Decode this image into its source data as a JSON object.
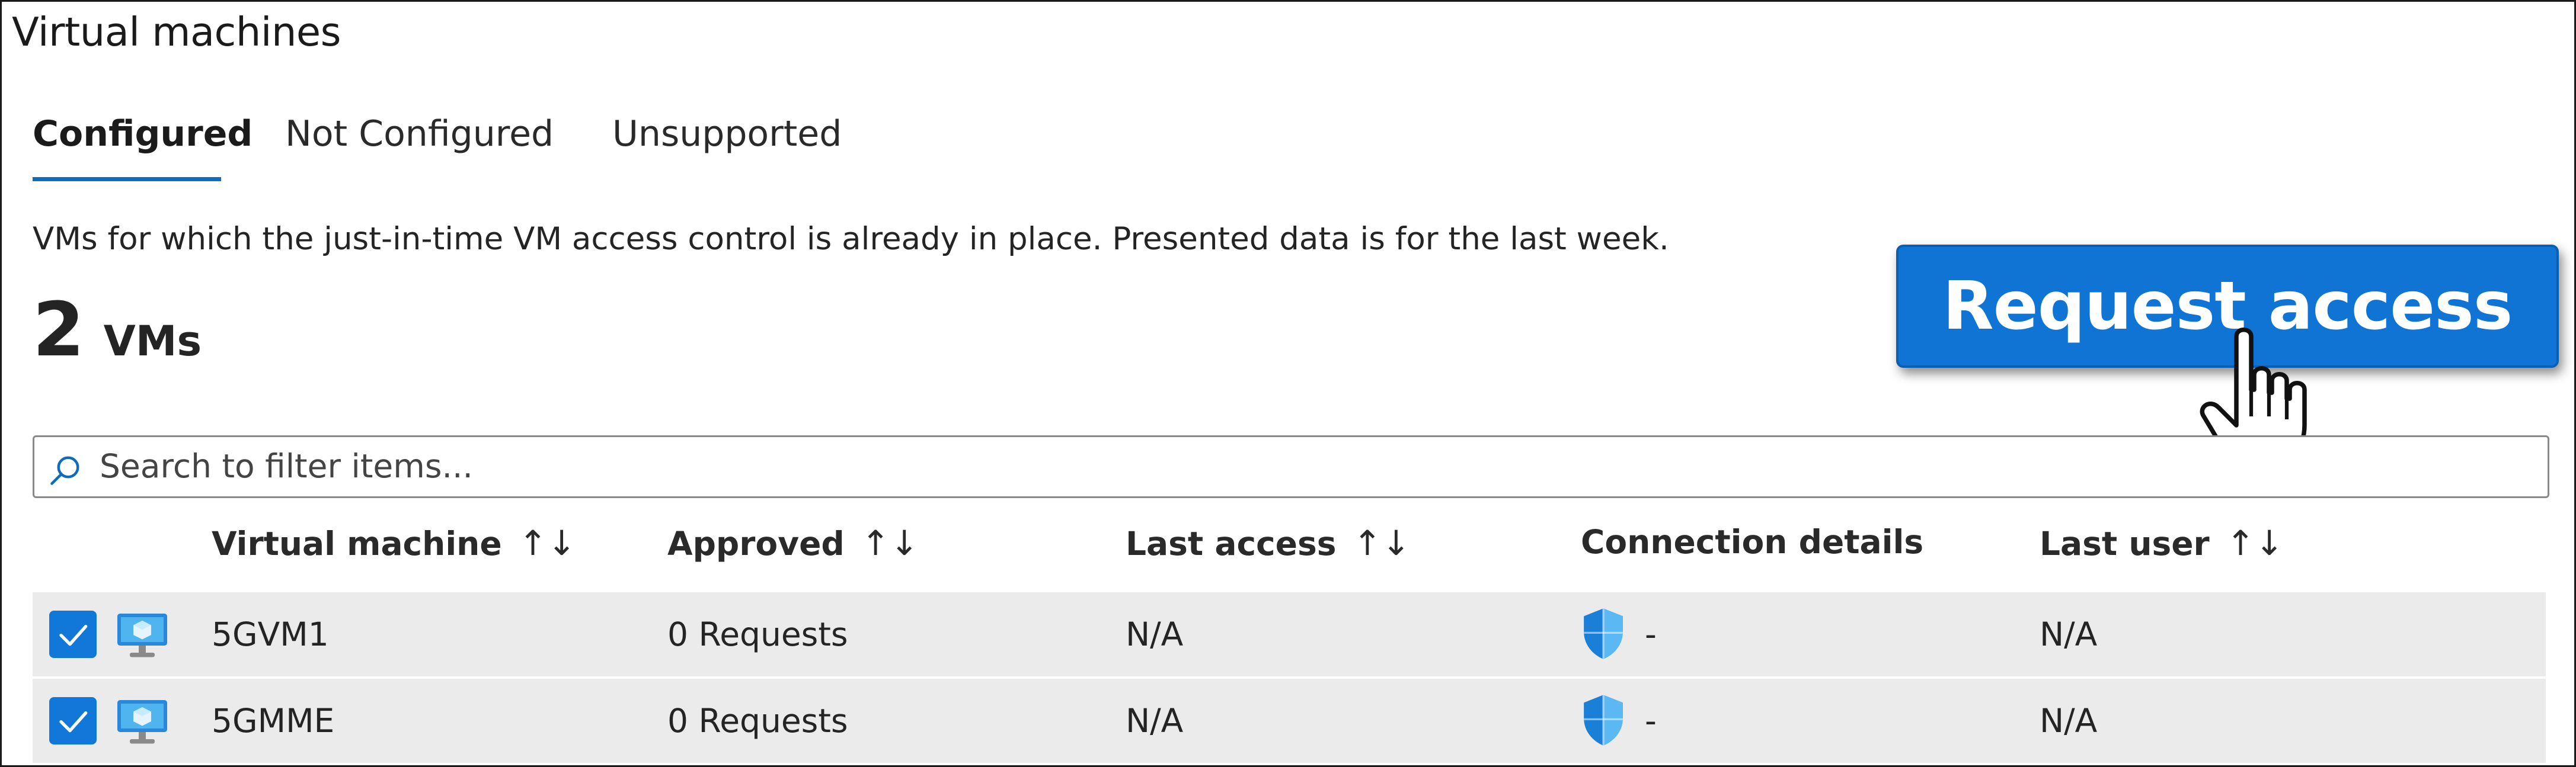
{
  "header": {
    "title": "Virtual machines"
  },
  "tabs": [
    {
      "label": "Configured",
      "active": true
    },
    {
      "label": "Not Configured",
      "active": false
    },
    {
      "label": "Unsupported",
      "active": false
    }
  ],
  "description": "VMs for which the just-in-time VM access control is already in place. Presented data is for the last week.",
  "count": {
    "number": "2",
    "unit": "VMs"
  },
  "request_button": {
    "label": "Request access"
  },
  "search": {
    "placeholder": "Search to filter items...",
    "value": ""
  },
  "table": {
    "columns": [
      {
        "label": "Virtual machine",
        "sortable": true
      },
      {
        "label": "Approved",
        "sortable": true
      },
      {
        "label": "Last access",
        "sortable": true
      },
      {
        "label": "Connection details",
        "sortable": false
      },
      {
        "label": "Last user",
        "sortable": true
      }
    ],
    "sort_glyph": "↑↓",
    "rows": [
      {
        "selected": true,
        "name": "5GVM1",
        "approved": "0 Requests",
        "last_access": "N/A",
        "connection": "-",
        "last_user": "N/A"
      },
      {
        "selected": true,
        "name": "5GMME",
        "approved": "0 Requests",
        "last_access": "N/A",
        "connection": "-",
        "last_user": "N/A"
      }
    ]
  },
  "colors": {
    "accent": "#0f6cbd",
    "button": "#0f74d4",
    "row_bg": "#ebebeb"
  },
  "icons": [
    "search-icon",
    "checkmark-icon",
    "virtual-machine-icon",
    "shield-icon",
    "hand-pointer-icon"
  ]
}
